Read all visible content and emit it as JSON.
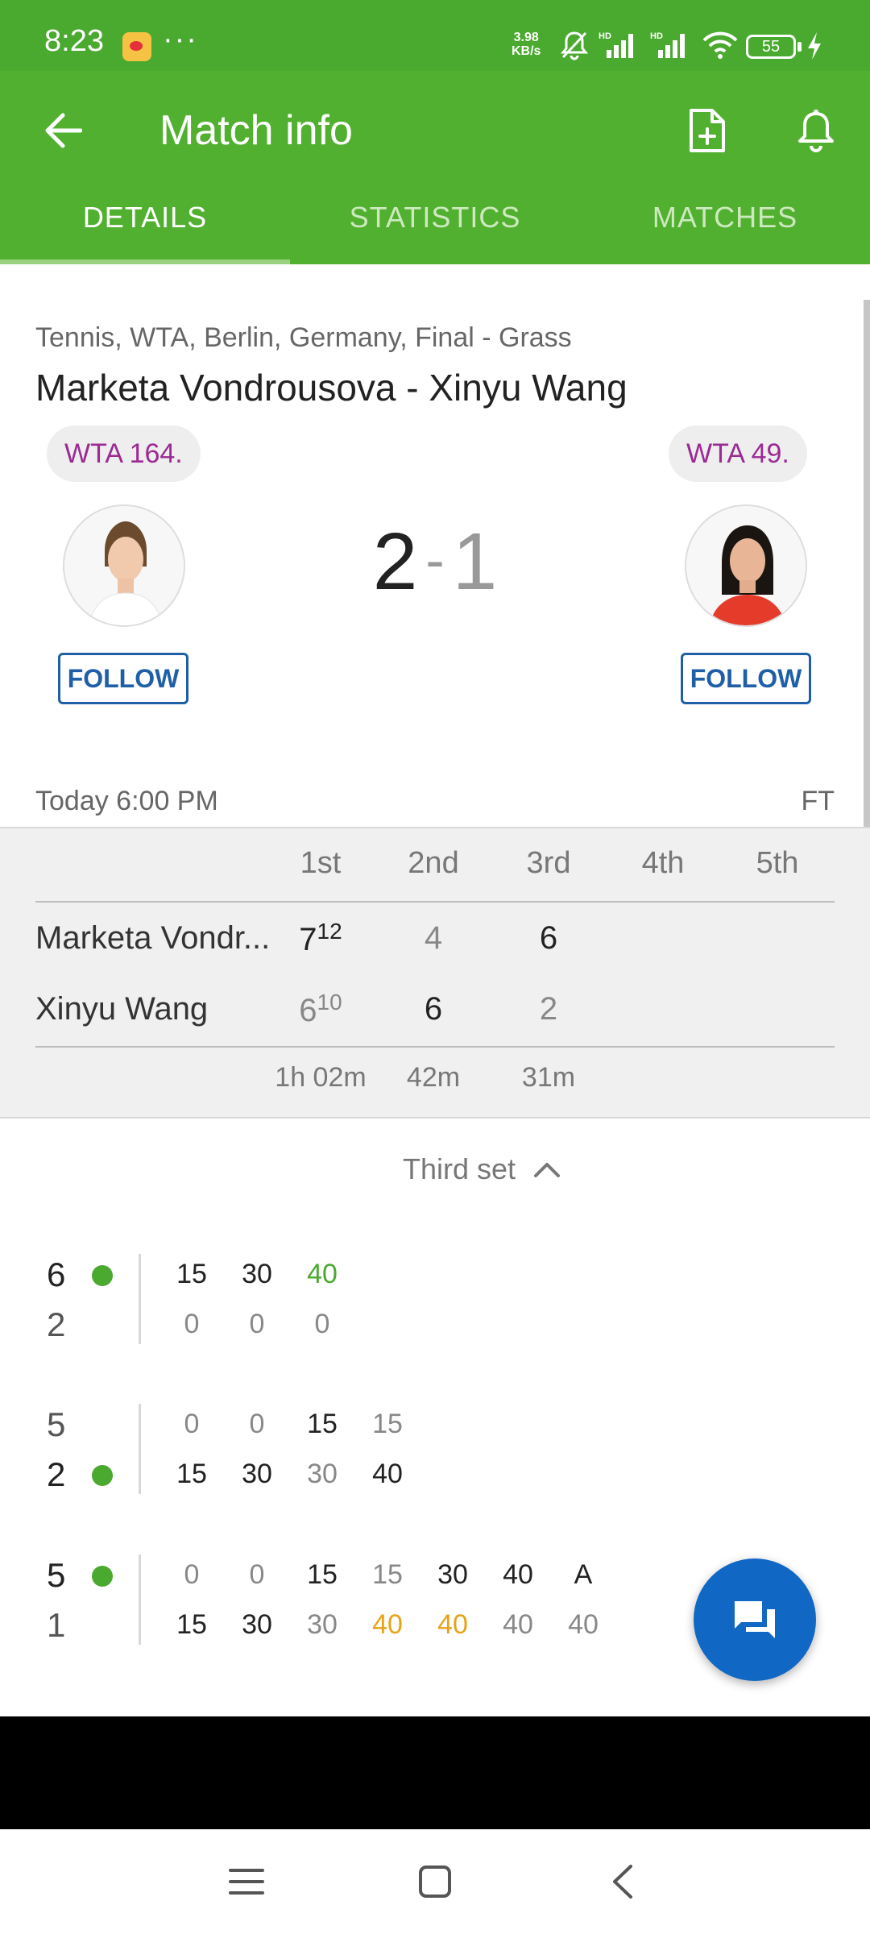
{
  "status_bar": {
    "time": "8:23",
    "dots": "···",
    "net_speed_value": "3.98",
    "net_speed_unit": "KB/s",
    "battery": "55",
    "icons": [
      "weibo-icon",
      "mute-bell-icon",
      "hd-signal-icon",
      "hd-signal-icon",
      "wifi-icon",
      "battery-icon",
      "charging-icon"
    ]
  },
  "header": {
    "title": "Match info",
    "tabs": [
      {
        "label": "DETAILS",
        "active": true
      },
      {
        "label": "STATISTICS",
        "active": false
      },
      {
        "label": "MATCHES",
        "active": false
      }
    ]
  },
  "match": {
    "meta": "Tennis, WTA, Berlin, Germany, Final - Grass",
    "title": "Marketa Vondrousova - Xinyu Wang",
    "home": {
      "rank": "WTA 164.",
      "follow": "FOLLOW",
      "sets_won": "2"
    },
    "away": {
      "rank": "WTA 49.",
      "follow": "FOLLOW",
      "sets_won": "1"
    },
    "score_separator": "-",
    "date": "Today 6:00 PM",
    "status": "FT"
  },
  "sets_table": {
    "columns": [
      "1st",
      "2nd",
      "3rd",
      "4th",
      "5th"
    ],
    "rows": [
      {
        "name": "Marketa Vondr...",
        "s1": "7",
        "s1_tb": "12",
        "s2": "4",
        "s3": "6"
      },
      {
        "name": "Xinyu Wang",
        "s1": "6",
        "s1_tb": "10",
        "s2": "6",
        "s3": "2"
      }
    ],
    "durations": [
      "1h 02m",
      "42m",
      "31m"
    ]
  },
  "set_toggle": {
    "label": "Third set"
  },
  "games": [
    {
      "home_score": "6",
      "away_score": "2",
      "server": "home",
      "home_points": [
        "15",
        "30",
        "40"
      ],
      "away_points": [
        "0",
        "0",
        "0"
      ]
    },
    {
      "home_score": "5",
      "away_score": "2",
      "server": "away",
      "home_points": [
        "0",
        "0",
        "15",
        "15"
      ],
      "away_points": [
        "15",
        "30",
        "30",
        "40"
      ]
    },
    {
      "home_score": "5",
      "away_score": "1",
      "server": "home",
      "home_points": [
        "0",
        "0",
        "15",
        "15",
        "30",
        "40",
        "A"
      ],
      "away_points": [
        "15",
        "30",
        "30",
        "40",
        "40",
        "40",
        "40"
      ]
    }
  ],
  "colors": {
    "status_bar": "#4aa92f",
    "app_bar": "#52b030",
    "serve_dot": "#4aa92f",
    "follow": "#1f5fa7",
    "rank_text": "#9b2a94",
    "break_point": "#e8a315",
    "fab": "#1067c4"
  }
}
